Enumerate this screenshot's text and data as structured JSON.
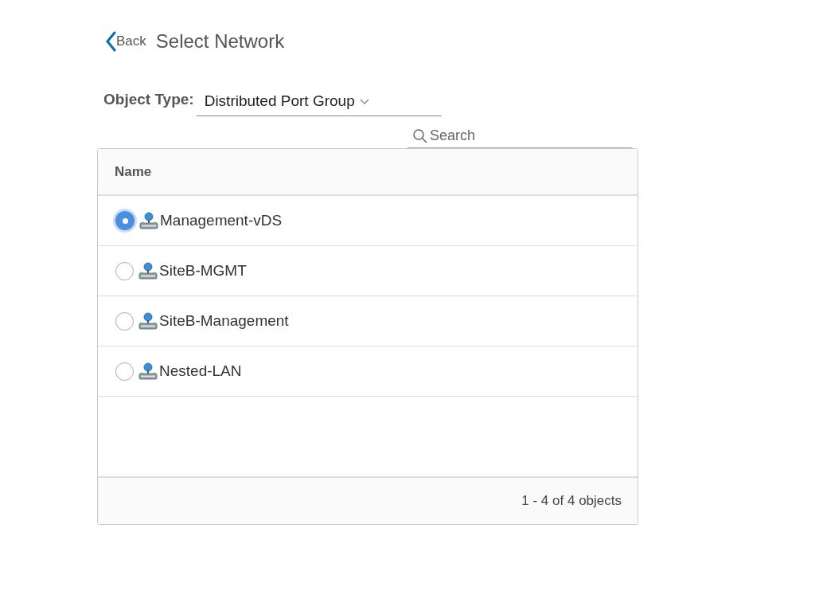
{
  "header": {
    "back": "Back",
    "title": "Select Network"
  },
  "object_type": {
    "label": "Object Type:",
    "value": "Distributed Port Group"
  },
  "search": {
    "placeholder": "Search"
  },
  "table": {
    "columns": [
      "Name"
    ],
    "rows": [
      {
        "name": "Management-vDS",
        "selected": true
      },
      {
        "name": "SiteB-MGMT",
        "selected": false
      },
      {
        "name": "SiteB-Management",
        "selected": false
      },
      {
        "name": "Nested-LAN",
        "selected": false
      }
    ],
    "footer": "1 - 4 of 4 objects"
  }
}
